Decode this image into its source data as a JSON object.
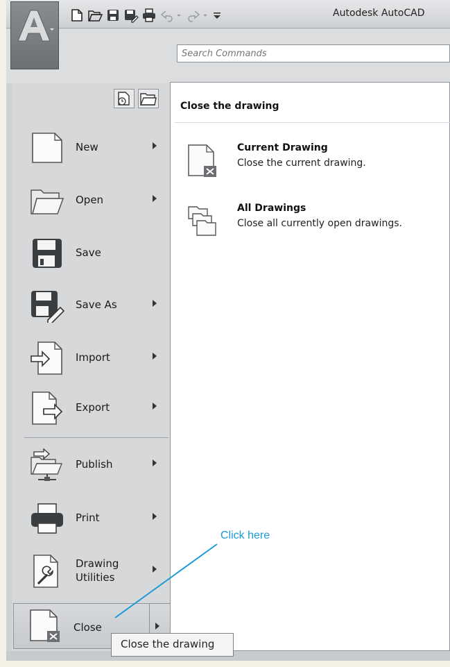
{
  "title_bar": {
    "title": "Autodesk AutoCAD"
  },
  "search": {
    "placeholder": "Search Commands"
  },
  "menu": {
    "items": [
      {
        "label": "New",
        "icon": "new-file-icon",
        "has_submenu": true
      },
      {
        "label": "Open",
        "icon": "open-folder-icon",
        "has_submenu": true
      },
      {
        "label": "Save",
        "icon": "save-disk-icon",
        "has_submenu": false
      },
      {
        "label": "Save As",
        "icon": "save-as-icon",
        "has_submenu": true
      },
      {
        "label": "Import",
        "icon": "import-icon",
        "has_submenu": true
      },
      {
        "label": "Export",
        "icon": "export-icon",
        "has_submenu": true
      },
      {
        "label": "Publish",
        "icon": "publish-icon",
        "has_submenu": true
      },
      {
        "label": "Print",
        "icon": "printer-icon",
        "has_submenu": true
      },
      {
        "label": "Drawing\nUtilities",
        "label_line1": "Drawing",
        "label_line2": "Utilities",
        "icon": "drawing-utilities-icon",
        "has_submenu": true
      },
      {
        "label": "Close",
        "icon": "close-drawing-icon",
        "has_submenu": true,
        "selected": true
      }
    ]
  },
  "panel": {
    "title": "Close the drawing",
    "options": [
      {
        "title": "Current Drawing",
        "description": "Close the current drawing.",
        "icon": "close-current-drawing-icon"
      },
      {
        "title": "All Drawings",
        "description": "Close all currently open drawings.",
        "icon": "close-all-drawings-icon"
      }
    ]
  },
  "tooltip": {
    "text": "Close the drawing"
  },
  "callout": {
    "text": "Click here",
    "color": "#1a9ad6"
  },
  "colors": {
    "panel_bg": "#ffffff",
    "menu_bg": "#d6d8da",
    "accent": "#1a9ad6"
  }
}
